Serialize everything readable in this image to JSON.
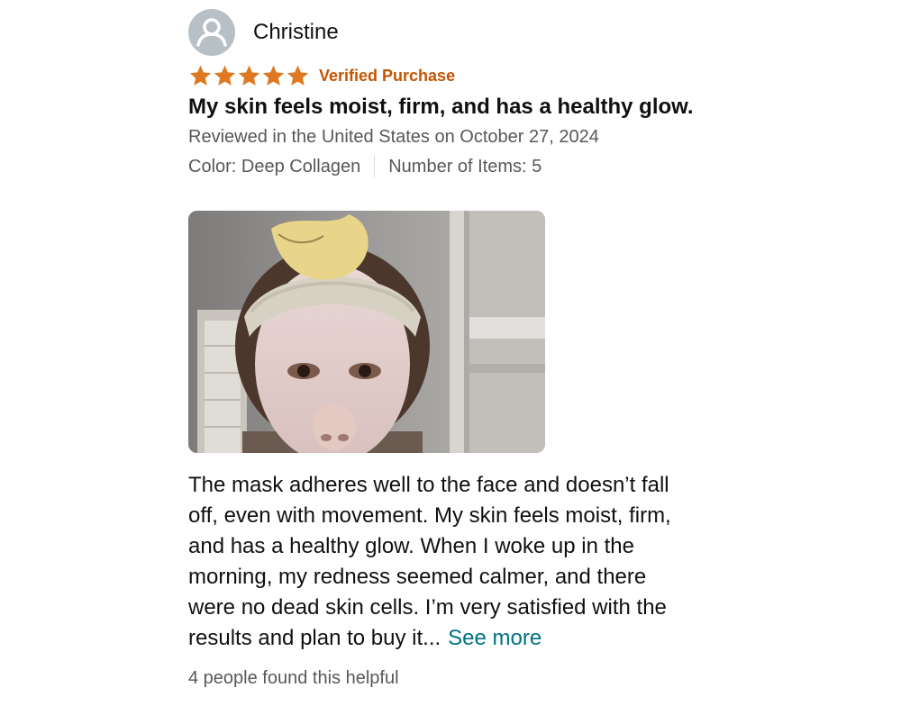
{
  "reviewer": {
    "name": "Christine",
    "avatar_icon": "user-silhouette-icon"
  },
  "rating": {
    "stars": 5,
    "max_stars": 5,
    "star_icon": "star-icon",
    "star_color": "#de7921",
    "verified_label": "Verified Purchase",
    "verified_color": "#c45500"
  },
  "review": {
    "title": "My skin feels moist, firm, and has a healthy glow.",
    "date_text": "Reviewed in the United States on October 27, 2024",
    "color_variant": "Color: Deep Collagen",
    "item_count": "Number of Items: 5",
    "body_lines": [
      "The mask adheres well to the face and doesn’t fall",
      "off, even with movement. My skin feels moist, firm,",
      "and has a healthy glow. When I woke up in the",
      "morning, my redness seemed calmer, and there",
      "were no dead skin cells. I’m very satisfied with the",
      "results and plan to buy it..."
    ],
    "see_more_label": "See more",
    "link_color": "#007185",
    "helpful_text": "4 people found this helpful"
  }
}
